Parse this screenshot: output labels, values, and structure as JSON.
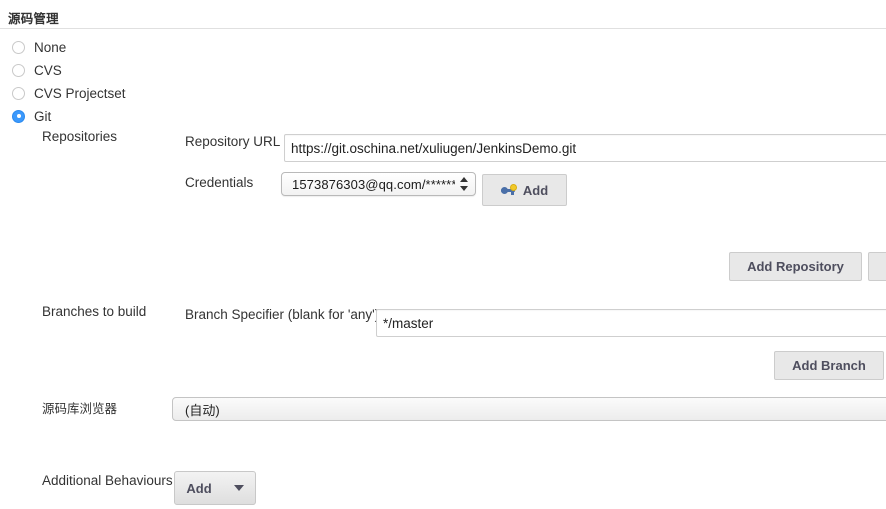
{
  "section": {
    "title": "源码管理"
  },
  "scm_options": [
    {
      "label": "None",
      "selected": false
    },
    {
      "label": "CVS",
      "selected": false
    },
    {
      "label": "CVS Projectset",
      "selected": false
    },
    {
      "label": "Git",
      "selected": true
    }
  ],
  "repositories": {
    "group_label": "Repositories",
    "url_label": "Repository URL",
    "url_value": "https://git.oschina.net/xuliugen/JenkinsDemo.git",
    "credentials_label": "Credentials",
    "credentials_value": "1573876303@qq.com/******",
    "credentials_add_label": "Add",
    "credentials_add_icon": "key-icon",
    "add_repository_label": "Add Repository"
  },
  "branches": {
    "group_label": "Branches to build",
    "specifier_label": "Branch Specifier (blank for 'any')",
    "specifier_value": "*/master",
    "add_branch_label": "Add Branch"
  },
  "repo_browser": {
    "label": "源码库浏览器",
    "value": "(自动)"
  },
  "additional_behaviours": {
    "label": "Additional Behaviours",
    "add_label": "Add",
    "caret_icon": "chevron-down-icon"
  },
  "colors": {
    "accent": "#3b99fc",
    "text": "#333333",
    "button_bg": "#e8e8e8",
    "border": "#cccccc",
    "rule": "#e0e0e0"
  }
}
